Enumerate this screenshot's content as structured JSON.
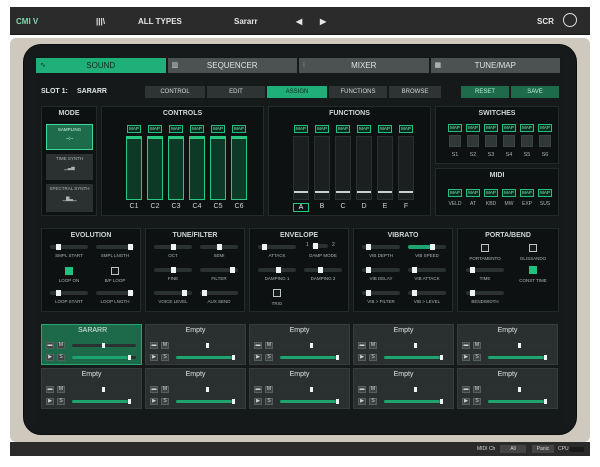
{
  "topbar": {
    "logo": "CMI V",
    "library_icon": "library-icon",
    "preset_filter": "ALL TYPES",
    "preset_name": "Sararr",
    "prev": "◀",
    "next": "▶",
    "scr_label": "SCR",
    "avatar_icon": "avatar-icon"
  },
  "tabs": [
    {
      "label": "SOUND"
    },
    {
      "label": "SEQUENCER"
    },
    {
      "label": "MIXER"
    },
    {
      "label": "TUNE/MAP"
    }
  ],
  "slot_label": "SLOT 1:",
  "slot_name": "SARARR",
  "subtabs": {
    "control": "CONTROL",
    "edit": "EDIT",
    "assign": "ASSIGN",
    "functions": "FUNCTIONS",
    "browse": "BROWSE",
    "reset": "RESET",
    "save": "SAVE"
  },
  "mode": {
    "title": "MODE",
    "items": [
      {
        "label": "SAMPLING",
        "active": true
      },
      {
        "label": "TIME SYNTH",
        "active": false
      },
      {
        "label": "SPECTRAL SYNTH",
        "active": false
      }
    ]
  },
  "controls": {
    "title": "CONTROLS",
    "map": "MAP",
    "labels": [
      "C1",
      "C2",
      "C3",
      "C4",
      "C5",
      "C6"
    ],
    "levels": [
      1.0,
      1.0,
      1.0,
      1.0,
      1.0,
      1.0
    ]
  },
  "functions": {
    "title": "FUNCTIONS",
    "map": "MAP",
    "labels": [
      "A",
      "B",
      "C",
      "D",
      "E",
      "F"
    ],
    "selected": "A"
  },
  "switches": {
    "title": "SWITCHES",
    "map": "MAP",
    "labels": [
      "S1",
      "S2",
      "S3",
      "S4",
      "S5",
      "S6"
    ]
  },
  "midi": {
    "title": "MIDI",
    "map": "MAP",
    "labels": [
      "VELD",
      "AT",
      "KBD",
      "MW",
      "EXP",
      "SUS"
    ]
  },
  "evolution": {
    "title": "EVOLUTION",
    "smpl_start": "SMPL START",
    "smpl_length": "SMPL LNGTH",
    "loop_on": "LOOP ON",
    "bf_loop": "B/F LOOP",
    "loop_start": "LOOP START",
    "loop_length": "LOOP LNGTH"
  },
  "tune_filter": {
    "title": "TUNE/FILTER",
    "oct": "OCT",
    "semi": "SEMI",
    "fine": "FINE",
    "filter": "FILTER",
    "voice_level": "VOICE LEVEL",
    "aux_send": "AUX SEND"
  },
  "envelope": {
    "title": "ENVELOPE",
    "attack": "ATTACK",
    "damp_mode": "DAMP MODE",
    "damp_1_num": "1",
    "damp_2_num": "2",
    "damping_1": "DAMPING 1",
    "damping_2": "DAMPING 2",
    "trig": "TRIG"
  },
  "vibrato": {
    "title": "VIBRATO",
    "vib_depth": "VIB DEPTH",
    "vib_speed": "VIB SPEED",
    "vib_delay": "VIB DELAY",
    "vib_attack": "VIB ATTACK",
    "vib_filter": "VIB > FILTER",
    "vib_level": "VIB > LEVEL"
  },
  "porta": {
    "title": "PORTA/BEND",
    "portamento": "PORTAMENTO",
    "glissando": "GLISSANDO",
    "time": "TIME",
    "const_time": "CONST TIME",
    "bendwidth": "BENDWIDTH"
  },
  "slots": [
    {
      "name": "SARARR",
      "selected": true
    },
    {
      "name": "Empty",
      "selected": false
    },
    {
      "name": "Empty",
      "selected": false
    },
    {
      "name": "Empty",
      "selected": false
    },
    {
      "name": "Empty",
      "selected": false
    },
    {
      "name": "Empty",
      "selected": false
    },
    {
      "name": "Empty",
      "selected": false
    },
    {
      "name": "Empty",
      "selected": false
    },
    {
      "name": "Empty",
      "selected": false
    },
    {
      "name": "Empty",
      "selected": false
    }
  ],
  "slot_buttons": {
    "m": "M",
    "s": "S"
  },
  "bottombar": {
    "midi_ch": "MIDI Ch",
    "all": "All",
    "panic": "Panic",
    "cpu": "CPU"
  },
  "colors": {
    "accent": "#1fb07a",
    "background": "#15191a",
    "frame": "#cfc9bd"
  }
}
